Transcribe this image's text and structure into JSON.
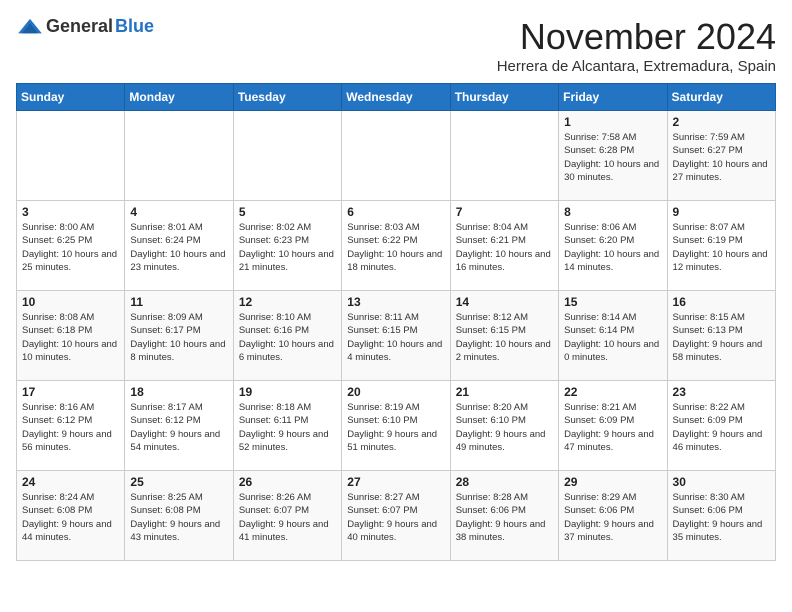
{
  "header": {
    "logo_general": "General",
    "logo_blue": "Blue",
    "month": "November 2024",
    "location": "Herrera de Alcantara, Extremadura, Spain"
  },
  "days_of_week": [
    "Sunday",
    "Monday",
    "Tuesday",
    "Wednesday",
    "Thursday",
    "Friday",
    "Saturday"
  ],
  "weeks": [
    [
      {
        "day": "",
        "info": ""
      },
      {
        "day": "",
        "info": ""
      },
      {
        "day": "",
        "info": ""
      },
      {
        "day": "",
        "info": ""
      },
      {
        "day": "",
        "info": ""
      },
      {
        "day": "1",
        "info": "Sunrise: 7:58 AM\nSunset: 6:28 PM\nDaylight: 10 hours and 30 minutes."
      },
      {
        "day": "2",
        "info": "Sunrise: 7:59 AM\nSunset: 6:27 PM\nDaylight: 10 hours and 27 minutes."
      }
    ],
    [
      {
        "day": "3",
        "info": "Sunrise: 8:00 AM\nSunset: 6:25 PM\nDaylight: 10 hours and 25 minutes."
      },
      {
        "day": "4",
        "info": "Sunrise: 8:01 AM\nSunset: 6:24 PM\nDaylight: 10 hours and 23 minutes."
      },
      {
        "day": "5",
        "info": "Sunrise: 8:02 AM\nSunset: 6:23 PM\nDaylight: 10 hours and 21 minutes."
      },
      {
        "day": "6",
        "info": "Sunrise: 8:03 AM\nSunset: 6:22 PM\nDaylight: 10 hours and 18 minutes."
      },
      {
        "day": "7",
        "info": "Sunrise: 8:04 AM\nSunset: 6:21 PM\nDaylight: 10 hours and 16 minutes."
      },
      {
        "day": "8",
        "info": "Sunrise: 8:06 AM\nSunset: 6:20 PM\nDaylight: 10 hours and 14 minutes."
      },
      {
        "day": "9",
        "info": "Sunrise: 8:07 AM\nSunset: 6:19 PM\nDaylight: 10 hours and 12 minutes."
      }
    ],
    [
      {
        "day": "10",
        "info": "Sunrise: 8:08 AM\nSunset: 6:18 PM\nDaylight: 10 hours and 10 minutes."
      },
      {
        "day": "11",
        "info": "Sunrise: 8:09 AM\nSunset: 6:17 PM\nDaylight: 10 hours and 8 minutes."
      },
      {
        "day": "12",
        "info": "Sunrise: 8:10 AM\nSunset: 6:16 PM\nDaylight: 10 hours and 6 minutes."
      },
      {
        "day": "13",
        "info": "Sunrise: 8:11 AM\nSunset: 6:15 PM\nDaylight: 10 hours and 4 minutes."
      },
      {
        "day": "14",
        "info": "Sunrise: 8:12 AM\nSunset: 6:15 PM\nDaylight: 10 hours and 2 minutes."
      },
      {
        "day": "15",
        "info": "Sunrise: 8:14 AM\nSunset: 6:14 PM\nDaylight: 10 hours and 0 minutes."
      },
      {
        "day": "16",
        "info": "Sunrise: 8:15 AM\nSunset: 6:13 PM\nDaylight: 9 hours and 58 minutes."
      }
    ],
    [
      {
        "day": "17",
        "info": "Sunrise: 8:16 AM\nSunset: 6:12 PM\nDaylight: 9 hours and 56 minutes."
      },
      {
        "day": "18",
        "info": "Sunrise: 8:17 AM\nSunset: 6:12 PM\nDaylight: 9 hours and 54 minutes."
      },
      {
        "day": "19",
        "info": "Sunrise: 8:18 AM\nSunset: 6:11 PM\nDaylight: 9 hours and 52 minutes."
      },
      {
        "day": "20",
        "info": "Sunrise: 8:19 AM\nSunset: 6:10 PM\nDaylight: 9 hours and 51 minutes."
      },
      {
        "day": "21",
        "info": "Sunrise: 8:20 AM\nSunset: 6:10 PM\nDaylight: 9 hours and 49 minutes."
      },
      {
        "day": "22",
        "info": "Sunrise: 8:21 AM\nSunset: 6:09 PM\nDaylight: 9 hours and 47 minutes."
      },
      {
        "day": "23",
        "info": "Sunrise: 8:22 AM\nSunset: 6:09 PM\nDaylight: 9 hours and 46 minutes."
      }
    ],
    [
      {
        "day": "24",
        "info": "Sunrise: 8:24 AM\nSunset: 6:08 PM\nDaylight: 9 hours and 44 minutes."
      },
      {
        "day": "25",
        "info": "Sunrise: 8:25 AM\nSunset: 6:08 PM\nDaylight: 9 hours and 43 minutes."
      },
      {
        "day": "26",
        "info": "Sunrise: 8:26 AM\nSunset: 6:07 PM\nDaylight: 9 hours and 41 minutes."
      },
      {
        "day": "27",
        "info": "Sunrise: 8:27 AM\nSunset: 6:07 PM\nDaylight: 9 hours and 40 minutes."
      },
      {
        "day": "28",
        "info": "Sunrise: 8:28 AM\nSunset: 6:06 PM\nDaylight: 9 hours and 38 minutes."
      },
      {
        "day": "29",
        "info": "Sunrise: 8:29 AM\nSunset: 6:06 PM\nDaylight: 9 hours and 37 minutes."
      },
      {
        "day": "30",
        "info": "Sunrise: 8:30 AM\nSunset: 6:06 PM\nDaylight: 9 hours and 35 minutes."
      }
    ]
  ]
}
